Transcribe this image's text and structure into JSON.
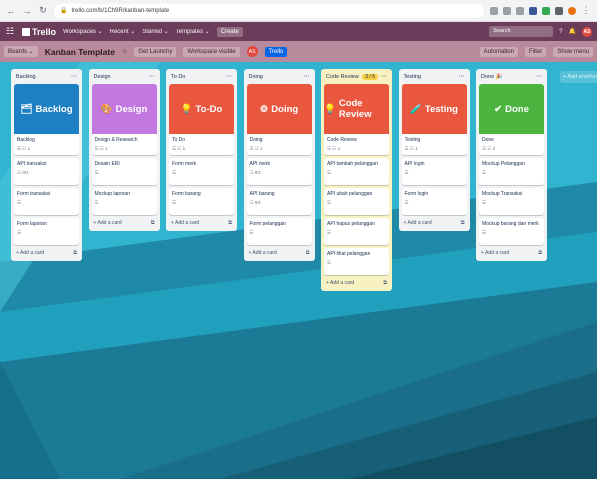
{
  "browser": {
    "url": "trello.com/b/1Ch9R/kanban-template"
  },
  "header": {
    "logo": "Trello",
    "menu": [
      "Workspaces ⌄",
      "Recent ⌄",
      "Starred ⌄",
      "Templates ⌄"
    ],
    "create": "Create",
    "search": "Search",
    "avatar": "AS"
  },
  "board": {
    "switch": "Boards ⌄",
    "title": "Kanban Template",
    "star": "☆",
    "launch": "Get Launchy",
    "visibility": "Workspace visible",
    "share": "Trello",
    "automation": "Automation",
    "filter": "Filter",
    "show_menu": "Show menu",
    "add_list": "+ Add another list"
  },
  "lists": [
    {
      "title": "Backlog",
      "cover": {
        "label": "Backlog",
        "icon": "🗂",
        "color": "#1d7fc4"
      },
      "cards": [
        {
          "title": "Backlog",
          "badges": "☰  ☷ 1"
        },
        {
          "title": "API transaksi",
          "badges": "☷ 0/1"
        },
        {
          "title": "Form transaksi",
          "badges": "☰"
        },
        {
          "title": "Form laporan",
          "badges": "☰"
        }
      ],
      "add": "+ Add a card"
    },
    {
      "title": "Design",
      "cover": {
        "label": "Design",
        "icon": "🎨",
        "color": "#c377e0"
      },
      "cards": [
        {
          "title": "Design & Research",
          "badges": "☰  ☷ 1"
        },
        {
          "title": "Desain ERI",
          "badges": "☰"
        },
        {
          "title": "Mockup laporan",
          "badges": "☰"
        }
      ],
      "add": "+ Add a card"
    },
    {
      "title": "To Do",
      "cover": {
        "label": "To-Do",
        "icon": "💡",
        "color": "#e9573f"
      },
      "cards": [
        {
          "title": "To Do",
          "badges": "☰  ☷ 1"
        },
        {
          "title": "Form merk",
          "badges": "☰"
        },
        {
          "title": "Form barang",
          "badges": "☰"
        }
      ],
      "add": "+ Add a card"
    },
    {
      "title": "Doing",
      "cover": {
        "label": "Doing",
        "icon": "⚙",
        "color": "#e9573f"
      },
      "cards": [
        {
          "title": "Doing",
          "badges": "☰  ☷ 1"
        },
        {
          "title": "API merk",
          "badges": "☷ 0/1"
        },
        {
          "title": "API barang",
          "badges": "☷ 0/1"
        },
        {
          "title": "Form pelanggan",
          "badges": "☰"
        }
      ],
      "add": "+ Add a card"
    },
    {
      "title": "Code Review",
      "count": "3 / 5",
      "cover": {
        "label": "Code Review",
        "icon": "💡",
        "color": "#e9573f"
      },
      "cards": [
        {
          "title": "Code Review",
          "badges": "☰  ☷ 1"
        },
        {
          "title": "API tambah pelanggan",
          "badges": "☰"
        },
        {
          "title": "API ubah pelanggan",
          "badges": "☰"
        },
        {
          "title": "API hapus pelanggan",
          "badges": "☰"
        },
        {
          "title": "API lihat pelanggan",
          "badges": "☰"
        }
      ],
      "add": "+ Add a card"
    },
    {
      "title": "Testing",
      "cover": {
        "label": "Testing",
        "icon": "🧪",
        "color": "#e9573f"
      },
      "cards": [
        {
          "title": "Testing",
          "badges": "☰  ☷ 1"
        },
        {
          "title": "API login",
          "badges": "☰"
        },
        {
          "title": "Form login",
          "badges": "☰"
        }
      ],
      "add": "+ Add a card"
    },
    {
      "title": "Done 🎉",
      "cover": {
        "label": "Done",
        "icon": "✔",
        "color": "#4bb53f"
      },
      "cards": [
        {
          "title": "Done",
          "badges": "☰  ☷ 2"
        },
        {
          "title": "Mockup Pelanggan",
          "badges": "☰"
        },
        {
          "title": "Mockup Transaksi",
          "badges": "☰"
        },
        {
          "title": "Mockup barang dan merk",
          "badges": "☰"
        }
      ],
      "add": "+ Add a card"
    }
  ]
}
